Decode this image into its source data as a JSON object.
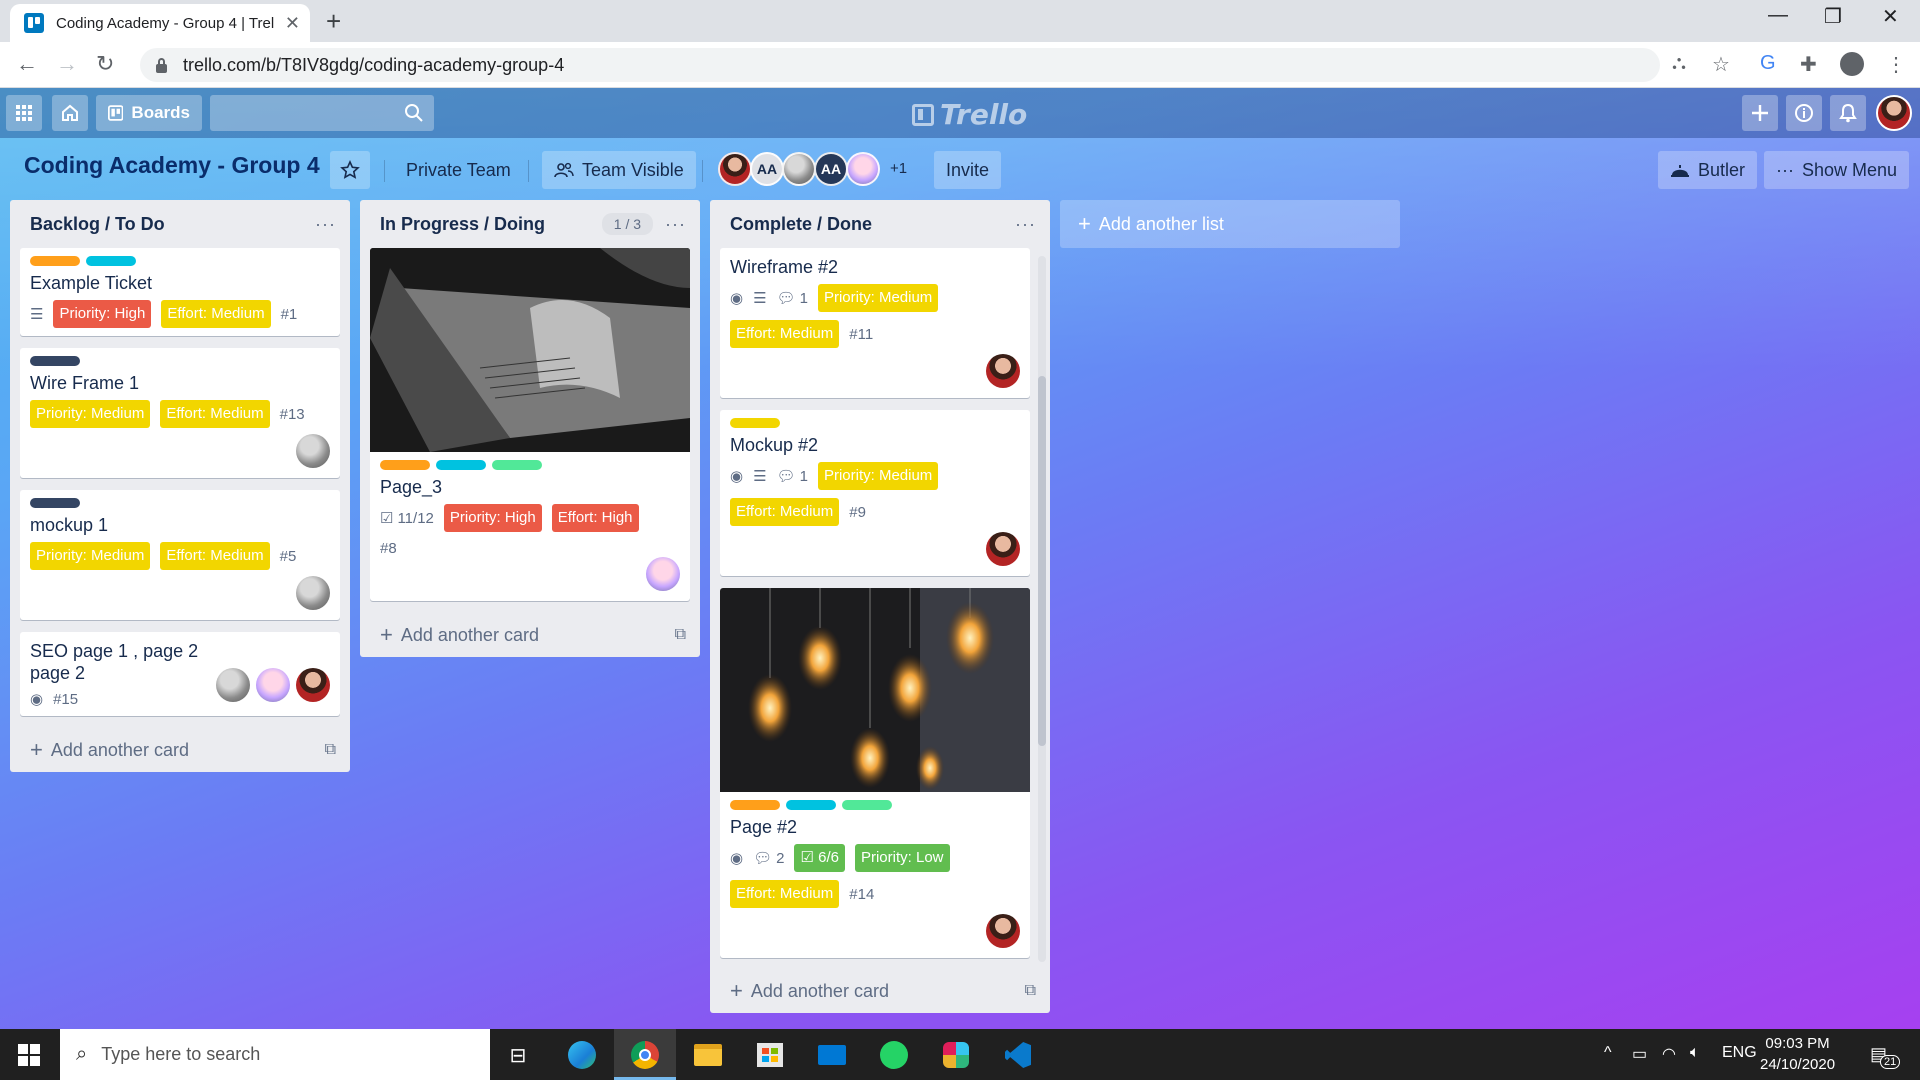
{
  "browser": {
    "tab_title": "Coding Academy - Group 4 | Trel",
    "url": "trello.com/b/T8IV8gdg/coding-academy-group-4",
    "new_tab_label": "+",
    "close_label": "✕",
    "min_label": "—",
    "max_label": "❐",
    "win_close_label": "✕"
  },
  "topnav": {
    "boards_label": "Boards",
    "logo_text": "Trello"
  },
  "board": {
    "title": "Coding Academy - Group 4",
    "visibility_team": "Private Team",
    "visibility_level": "Team Visible",
    "member_initials_1": "AA",
    "member_initials_2": "AA",
    "members_more": "+1",
    "invite_label": "Invite",
    "butler_label": "Butler",
    "show_menu_label": "Show Menu"
  },
  "lists": [
    {
      "title": "Backlog / To Do",
      "add_card": "Add another card",
      "cards": [
        {
          "title": "Example Ticket",
          "labels": [
            "#ff9f1a",
            "#00c2e0"
          ],
          "chips": [
            {
              "text": "Priority: High",
              "color": "red"
            },
            {
              "text": "Effort: Medium",
              "color": "yellow"
            }
          ],
          "number": "#1",
          "has_desc": true
        },
        {
          "title": "Wire Frame 1",
          "labels": [
            "#344563"
          ],
          "chips": [
            {
              "text": "Priority: Medium",
              "color": "yellow"
            },
            {
              "text": "Effort: Medium",
              "color": "yellow"
            }
          ],
          "number": "#13",
          "members": [
            "grey"
          ]
        },
        {
          "title": "mockup 1",
          "labels": [
            "#344563"
          ],
          "chips": [
            {
              "text": "Priority: Medium",
              "color": "yellow"
            },
            {
              "text": "Effort: Medium",
              "color": "yellow"
            }
          ],
          "number": "#5",
          "members": [
            "grey"
          ]
        },
        {
          "title": "SEO page 1 , page 2 page 2",
          "number": "#15",
          "has_watch": true,
          "members": [
            "grey",
            "pink",
            "red"
          ]
        }
      ]
    },
    {
      "title": "In Progress / Doing",
      "count": "1 / 3",
      "add_card": "Add another card",
      "cards": [
        {
          "title": "Page_3",
          "cover": "laptop",
          "labels": [
            "#ff9f1a",
            "#00c2e0",
            "#51e898"
          ],
          "checklist": "11/12",
          "chips": [
            {
              "text": "Priority: High",
              "color": "red"
            },
            {
              "text": "Effort: High",
              "color": "red"
            }
          ],
          "number": "#8",
          "members": [
            "pink"
          ]
        }
      ]
    },
    {
      "title": "Complete / Done",
      "add_card": "Add another card",
      "cards": [
        {
          "title": "Wireframe #2",
          "has_watch": true,
          "has_desc": true,
          "comments": "1",
          "chips": [
            {
              "text": "Priority: Medium",
              "color": "yellow"
            },
            {
              "text": "Effort: Medium",
              "color": "yellow"
            }
          ],
          "number": "#11",
          "members": [
            "red"
          ]
        },
        {
          "title": "Mockup #2",
          "labels": [
            "#f2d600"
          ],
          "has_watch": true,
          "has_desc": true,
          "comments": "1",
          "chips": [
            {
              "text": "Priority: Medium",
              "color": "yellow"
            },
            {
              "text": "Effort: Medium",
              "color": "yellow"
            }
          ],
          "number": "#9",
          "members": [
            "red"
          ]
        },
        {
          "title": "Page #2",
          "cover": "bulbs",
          "labels": [
            "#ff9f1a",
            "#00c2e0",
            "#51e898"
          ],
          "has_watch": true,
          "comments": "2",
          "checklist_done": "6/6",
          "chips": [
            {
              "text": "Priority: Low",
              "color": "green"
            },
            {
              "text": "Effort: Medium",
              "color": "yellow"
            }
          ],
          "number": "#14",
          "members": [
            "red"
          ]
        }
      ]
    }
  ],
  "add_list_label": "Add another list",
  "taskbar": {
    "search_placeholder": "Type here to search",
    "lang": "ENG",
    "time": "09:03 PM",
    "date": "24/10/2020",
    "notifications": "21"
  },
  "colors": {
    "label_orange": "#ff9f1a",
    "label_sky": "#00c2e0",
    "label_lime": "#51e898",
    "label_black": "#344563",
    "label_yellow": "#f2d600",
    "chip_red": "#eb5a46",
    "chip_yellow": "#f2d600",
    "chip_green": "#61bd4f"
  }
}
